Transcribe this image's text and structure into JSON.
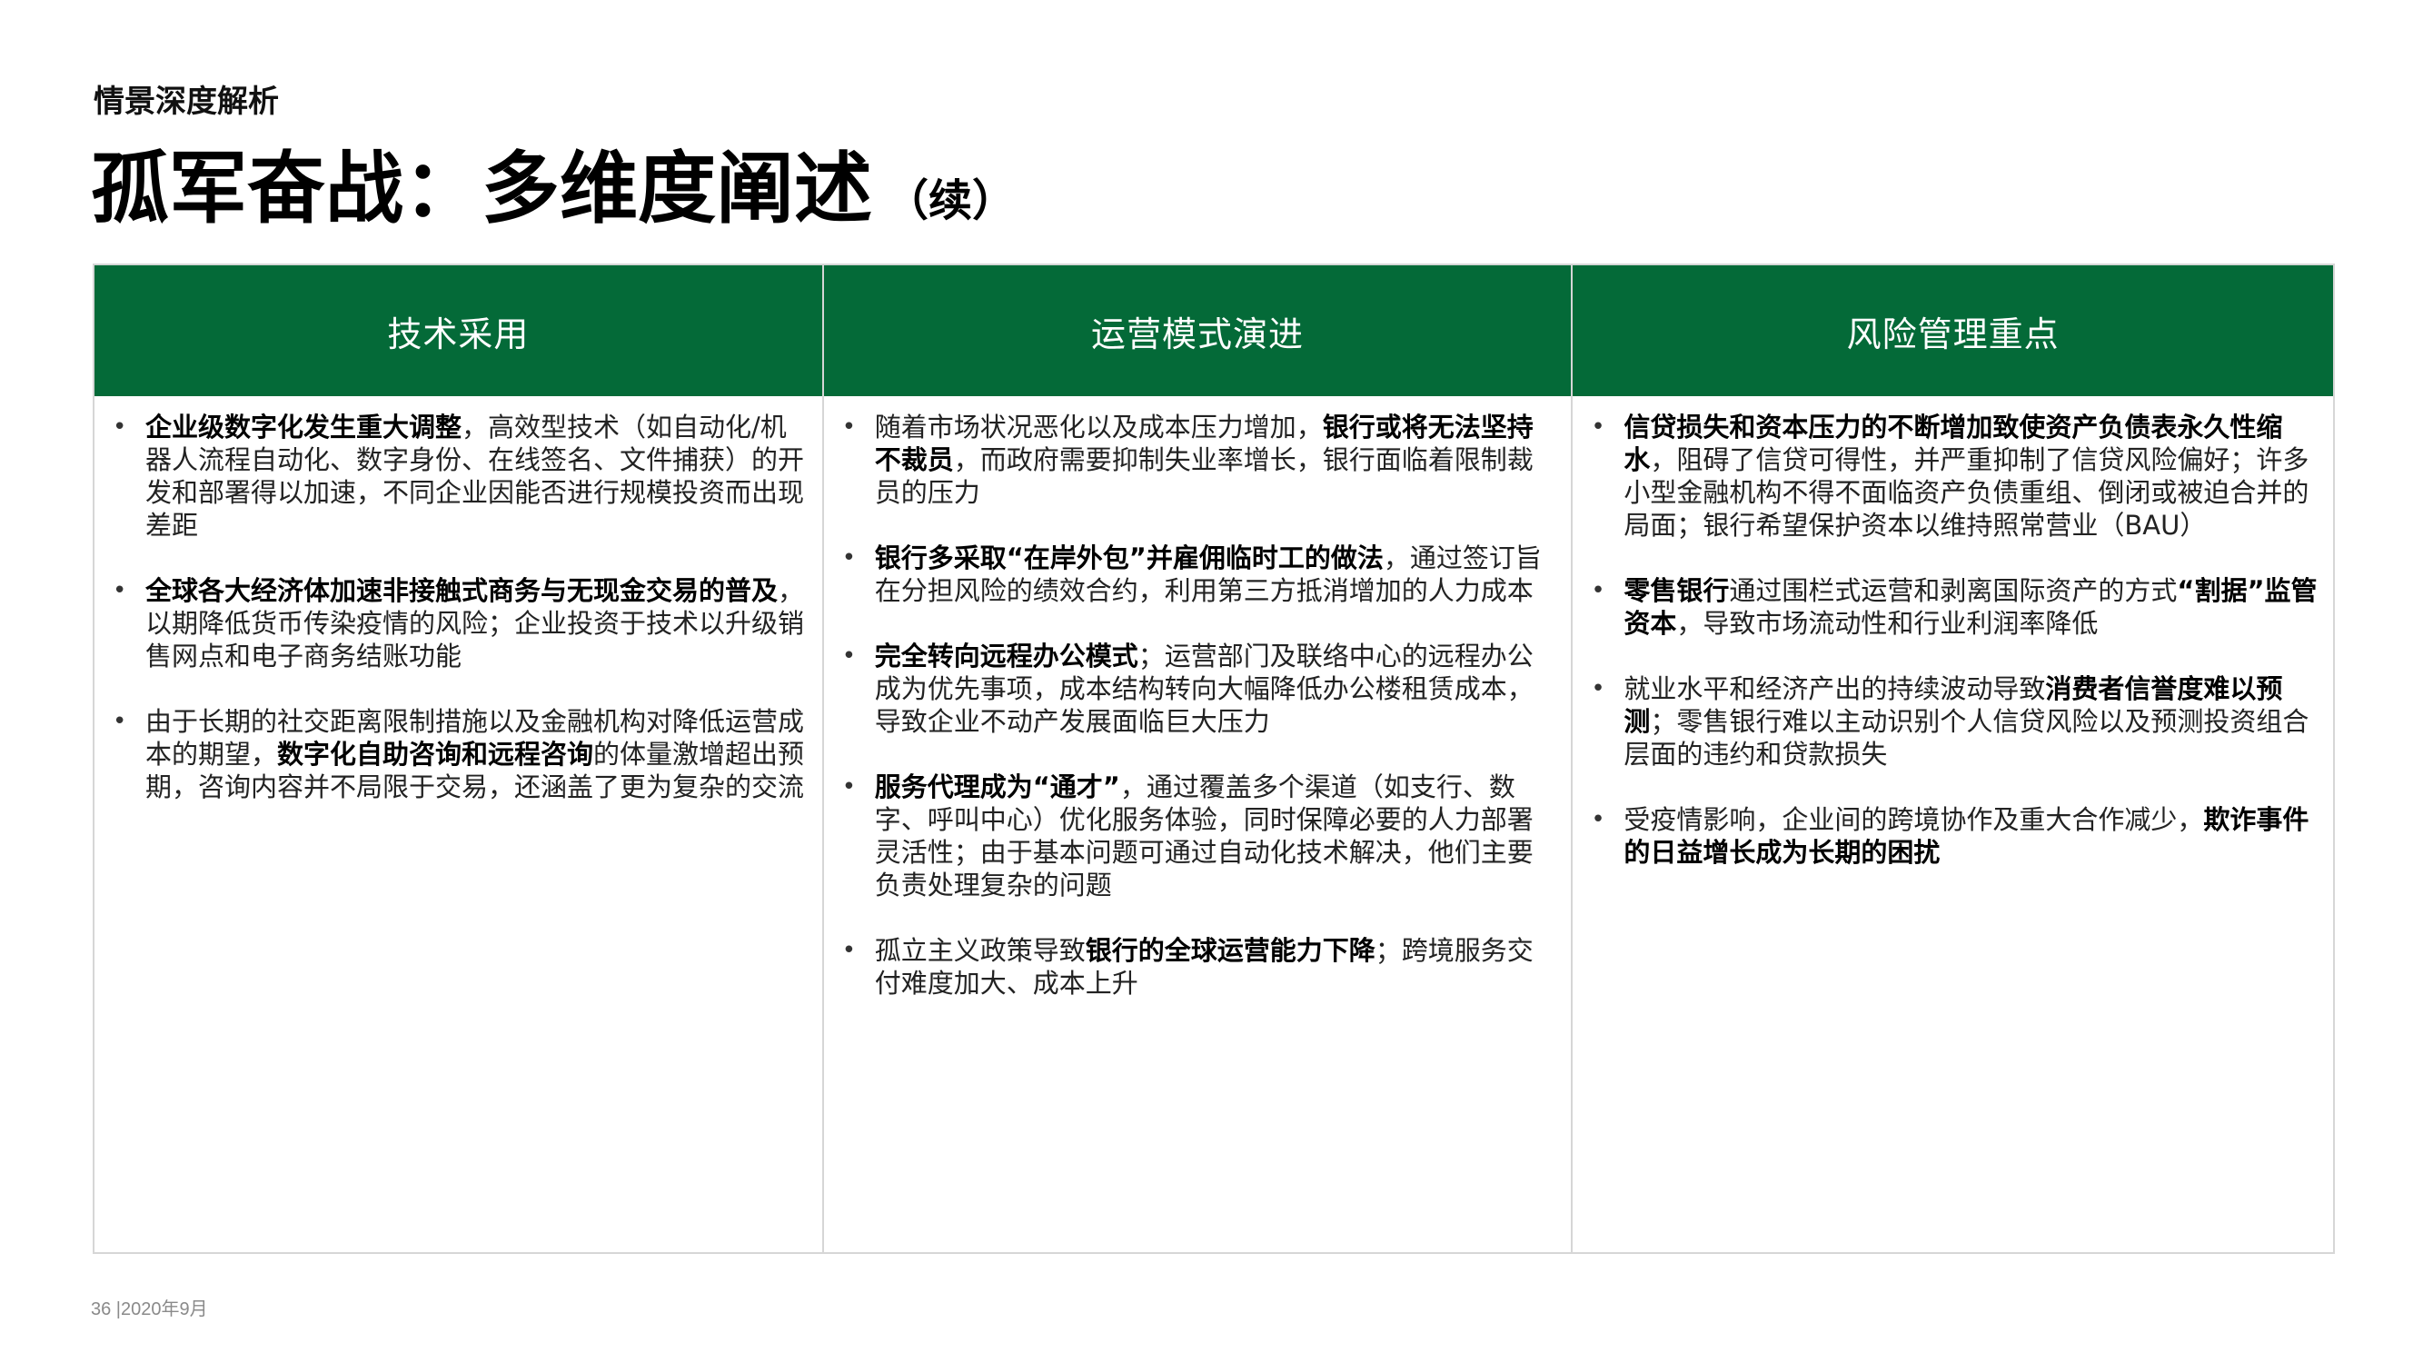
{
  "header": {
    "section_label": "情景深度解析",
    "title": "孤军奋战：多维度阐述",
    "title_suffix": "（续）"
  },
  "columns": [
    {
      "title": "技术采用",
      "bullets": [
        [
          {
            "t": "企业级数字化发生重大调整",
            "b": true
          },
          {
            "t": "，高效型技术（如自动化/机器人流程自动化、数字身份、在线签名、文件捕获）的开发和部署得以加速，不同企业因能否进行规模投资而出现差距",
            "b": false
          }
        ],
        [
          {
            "t": "全球各大经济体加速非接触式商务与无现金交易的普及",
            "b": true
          },
          {
            "t": "，以期降低货币传染疫情的风险；企业投资于技术以升级销售网点和电子商务结账功能",
            "b": false
          }
        ],
        [
          {
            "t": "由于长期的社交距离限制措施以及金融机构对降低运营成本的期望，",
            "b": false
          },
          {
            "t": "数字化自助咨询和远程咨询",
            "b": true
          },
          {
            "t": "的体量激增超出预期，咨询内容并不局限于交易，还涵盖了更为复杂的交流",
            "b": false
          }
        ]
      ]
    },
    {
      "title": "运营模式演进",
      "bullets": [
        [
          {
            "t": "随着市场状况恶化以及成本压力增加，",
            "b": false
          },
          {
            "t": "银行或将无法坚持不裁员",
            "b": true
          },
          {
            "t": "，而政府需要抑制失业率增长，银行面临着限制裁员的压力",
            "b": false
          }
        ],
        [
          {
            "t": "银行多采取“在岸外包”并雇佣临时工的做法",
            "b": true
          },
          {
            "t": "，通过签订旨在分担风险的绩效合约，利用第三方抵消增加的人力成本",
            "b": false
          }
        ],
        [
          {
            "t": "完全转向远程办公模式",
            "b": true
          },
          {
            "t": "；运营部门及联络中心的远程办公成为优先事项，成本结构转向大幅降低办公楼租赁成本，导致企业不动产发展面临巨大压力",
            "b": false
          }
        ],
        [
          {
            "t": "服务代理成为“通才”",
            "b": true
          },
          {
            "t": "，通过覆盖多个渠道（如支行、数字、呼叫中心）优化服务体验，同时保障必要的人力部署灵活性；由于基本问题可通过自动化技术解决，他们主要负责处理复杂的问题",
            "b": false
          }
        ],
        [
          {
            "t": "孤立主义政策导致",
            "b": false
          },
          {
            "t": "银行的全球运营能力下降",
            "b": true
          },
          {
            "t": "；跨境服务交付难度加大、成本上升",
            "b": false
          }
        ]
      ]
    },
    {
      "title": "风险管理重点",
      "bullets": [
        [
          {
            "t": "信贷损失和资本压力的不断增加致使资产负债表永久性缩水",
            "b": true
          },
          {
            "t": "，阻碍了信贷可得性，并严重抑制了信贷风险偏好；许多小型金融机构不得不面临资产负债重组、倒闭或被迫合并的局面；银行希望保护资本以维持照常营业（BAU）",
            "b": false
          }
        ],
        [
          {
            "t": "零售银行",
            "b": true
          },
          {
            "t": "通过围栏式运营和剥离国际资产的方式",
            "b": false
          },
          {
            "t": "“割据”监管资本",
            "b": true
          },
          {
            "t": "，导致市场流动性和行业利润率降低",
            "b": false
          }
        ],
        [
          {
            "t": "就业水平和经济产出的持续波动导致",
            "b": false
          },
          {
            "t": "消费者信誉度难以预测",
            "b": true
          },
          {
            "t": "；零售银行难以主动识别个人信贷风险以及预测投资组合层面的违约和贷款损失",
            "b": false
          }
        ],
        [
          {
            "t": "受疫情影响，企业间的跨境协作及重大合作减少，",
            "b": false
          },
          {
            "t": "欺诈事件的日益增长成为长期的困扰",
            "b": true
          }
        ]
      ]
    }
  ],
  "footer": {
    "text": "36 |2020年9月"
  },
  "colors": {
    "header_green": "#046a38",
    "border_gray": "#d6d6d6"
  }
}
